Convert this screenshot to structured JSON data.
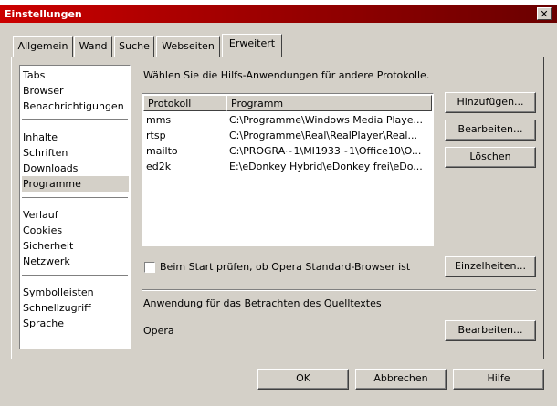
{
  "window": {
    "title": "Einstellungen",
    "close_glyph": "✕"
  },
  "tabs": [
    {
      "label": "Allgemein"
    },
    {
      "label": "Wand"
    },
    {
      "label": "Suche"
    },
    {
      "label": "Webseiten"
    },
    {
      "label": "Erweitert",
      "active": true
    }
  ],
  "sidebar": {
    "groups": [
      [
        "Tabs",
        "Browser",
        "Benachrichtigungen"
      ],
      [
        "Inhalte",
        "Schriften",
        "Downloads",
        "Programme"
      ],
      [
        "Verlauf",
        "Cookies",
        "Sicherheit",
        "Netzwerk"
      ],
      [
        "Symbolleisten",
        "Schnellzugriff",
        "Sprache"
      ]
    ],
    "selected": "Programme"
  },
  "main": {
    "intro": "Wählen Sie die Hilfs-Anwendungen für andere Protokolle.",
    "table": {
      "columns": [
        "Protokoll",
        "Programm"
      ],
      "rows": [
        [
          "mms",
          "C:\\Programme\\Windows Media Playe..."
        ],
        [
          "rtsp",
          "C:\\Programme\\Real\\RealPlayer\\Real..."
        ],
        [
          "mailto",
          "C:\\PROGRA~1\\MI1933~1\\Office10\\O..."
        ],
        [
          "ed2k",
          "E:\\eDonkey Hybrid\\eDonkey frei\\eDo..."
        ]
      ]
    },
    "buttons": {
      "add": "Hinzufügen...",
      "edit": "Bearbeiten...",
      "delete": "Löschen"
    },
    "checkbox_label": "Beim Start prüfen, ob Opera Standard-Browser ist",
    "details_button": "Einzelheiten...",
    "source_label": "Anwendung für das Betrachten des Quelltextes",
    "source_app": "Opera",
    "source_edit_button": "Bearbeiten..."
  },
  "footer": {
    "ok": "OK",
    "cancel": "Abbrechen",
    "help": "Hilfe"
  }
}
